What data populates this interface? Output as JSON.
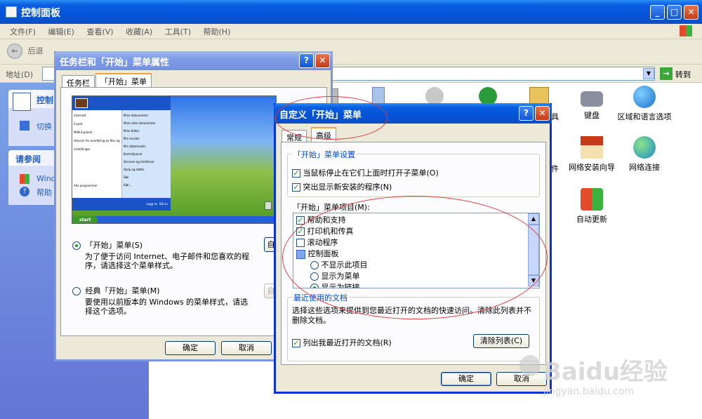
{
  "cp_window": {
    "title": "控制面板",
    "menu": [
      "文件(F)",
      "编辑(E)",
      "查看(V)",
      "收藏(A)",
      "工具(T)",
      "帮助(H)"
    ],
    "back_label": "后退",
    "address_label": "地址(D)",
    "go_label": "转到",
    "sidebar": {
      "panel_title": "控制",
      "switch_label": "切换",
      "see_also_title": "请参阅",
      "link1": "Wind",
      "link2": "帮助"
    },
    "icons": [
      {
        "label": "键盘"
      },
      {
        "label": "区域和语言选项"
      },
      {
        "label": "网络安装向导"
      },
      {
        "label": "网络连接"
      },
      {
        "label": "自动更新"
      }
    ],
    "partial_label1": "具",
    "partial_label2": "件"
  },
  "taskbar_dialog": {
    "title": "任务栏和「开始」菜单属性",
    "tabs": [
      "任务栏",
      "「开始」菜单"
    ],
    "radio1_label": "「开始」菜单(S)",
    "radio1_desc": "为了便于访问 Internet、电子邮件和您喜欢的程序，请选择这个菜单样式。",
    "radio2_label": "经典「开始」菜单(M)",
    "radio2_desc": "要使用以前版本的 Windows 的菜单样式，请选择这个选项。",
    "customize_btn_partial": "自",
    "ok_label": "确定",
    "cancel_label": "取消",
    "preview": {
      "start_label": "start",
      "all_programs": "Alle programmer",
      "left_items": [
        "Internett",
        "E-post",
        "MSN Explorer",
        "Veiviser for overføring av filer og innstillinger"
      ],
      "right_items": [
        "Mine dokumenter",
        "Mine siste dokumenter",
        "Mine bilder",
        "Min musikk",
        "Min datamaskin",
        "Kontrollpanel",
        "Skrivere og telefakser",
        "Hjelp og støtte",
        "Søk",
        "Kjør..."
      ],
      "logoff": "Logg av",
      "shutdown": "Slå av"
    }
  },
  "custom_dialog": {
    "title": "自定义「开始」菜单",
    "tabs": [
      "常规",
      "高级"
    ],
    "settings_group": "「开始」菜单设置",
    "setting1": "当鼠标停止在它们上面时打开子菜单(O)",
    "setting2": "突出显示新安装的程序(N)",
    "items_label": "「开始」菜单项目(M):",
    "list_items": [
      {
        "label": "帮助和支持",
        "type": "check",
        "checked": true
      },
      {
        "label": "打印机和传真",
        "type": "check",
        "checked": true
      },
      {
        "label": "滚动程序",
        "type": "check",
        "checked": false
      },
      {
        "label": "控制面板",
        "type": "header"
      },
      {
        "label": "不显示此项目",
        "type": "radio",
        "checked": false
      },
      {
        "label": "显示为菜单",
        "type": "radio",
        "checked": false
      },
      {
        "label": "显示为链接",
        "type": "radio",
        "checked": true
      }
    ],
    "recent_group": "最近使用的文档",
    "recent_desc": "选择这些选项来提供到您最近打开的文档的快速访问。清除此列表并不删除文档。",
    "recent_check": "列出我最近打开的文档(R)",
    "clear_btn": "清除列表(C)",
    "ok_label": "确定",
    "cancel_label": "取消"
  },
  "watermark": {
    "brand": "Baidu经验",
    "url": "jingyan.baidu.com"
  }
}
